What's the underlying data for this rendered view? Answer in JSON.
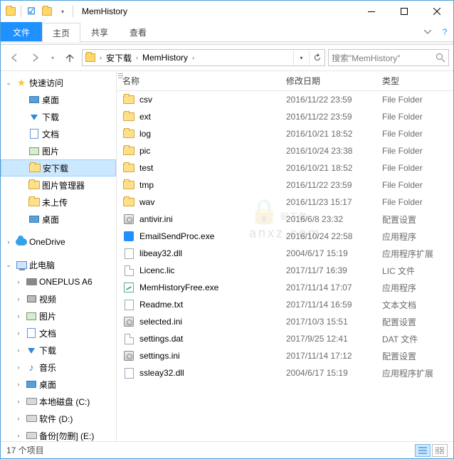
{
  "title": "MemHistory",
  "tabs": {
    "file": "文件",
    "home": "主页",
    "share": "共享",
    "view": "查看"
  },
  "breadcrumb": [
    "安下载",
    "MemHistory"
  ],
  "search_placeholder": "搜索\"MemHistory\"",
  "columns": {
    "name": "名称",
    "date": "修改日期",
    "type": "类型"
  },
  "items": [
    {
      "icon": "folder",
      "name": "csv",
      "date": "2016/11/22 23:59",
      "type": "File Folder"
    },
    {
      "icon": "folder",
      "name": "ext",
      "date": "2016/11/22 23:59",
      "type": "File Folder"
    },
    {
      "icon": "folder",
      "name": "log",
      "date": "2016/10/21 18:52",
      "type": "File Folder"
    },
    {
      "icon": "folder",
      "name": "pic",
      "date": "2016/10/24 23:38",
      "type": "File Folder"
    },
    {
      "icon": "folder",
      "name": "test",
      "date": "2016/10/21 18:52",
      "type": "File Folder"
    },
    {
      "icon": "folder",
      "name": "tmp",
      "date": "2016/11/22 23:59",
      "type": "File Folder"
    },
    {
      "icon": "folder",
      "name": "wav",
      "date": "2016/11/23 15:17",
      "type": "File Folder"
    },
    {
      "icon": "set",
      "name": "antivir.ini",
      "date": "2016/6/8 23:32",
      "type": "配置设置"
    },
    {
      "icon": "exe",
      "name": "EmailSendProc.exe",
      "date": "2016/10/24 22:58",
      "type": "应用程序"
    },
    {
      "icon": "dll",
      "name": "libeay32.dll",
      "date": "2004/6/17 15:19",
      "type": "应用程序扩展"
    },
    {
      "icon": "file",
      "name": "Licenc.lic",
      "date": "2017/11/7 16:39",
      "type": "LIC 文件"
    },
    {
      "icon": "exe2",
      "name": "MemHistoryFree.exe",
      "date": "2017/11/14 17:07",
      "type": "应用程序"
    },
    {
      "icon": "txt",
      "name": "Readme.txt",
      "date": "2017/11/14 16:59",
      "type": "文本文档"
    },
    {
      "icon": "set",
      "name": "selected.ini",
      "date": "2017/10/3 15:51",
      "type": "配置设置"
    },
    {
      "icon": "file",
      "name": "settings.dat",
      "date": "2017/9/25 12:41",
      "type": "DAT 文件"
    },
    {
      "icon": "set",
      "name": "settings.ini",
      "date": "2017/11/14 17:12",
      "type": "配置设置"
    },
    {
      "icon": "dll",
      "name": "ssleay32.dll",
      "date": "2004/6/17 15:19",
      "type": "应用程序扩展"
    }
  ],
  "sidebar": {
    "quick": "快速访问",
    "desktop": "桌面",
    "downloads": "下载",
    "documents": "文档",
    "pictures": "图片",
    "andl": "安下载",
    "picmgr": "图片管理器",
    "noupload": "未上传",
    "desktop2": "桌面",
    "onedrive": "OneDrive",
    "thispc": "此电脑",
    "oneplus": "ONEPLUS A6",
    "video": "视频",
    "pictures2": "图片",
    "documents2": "文档",
    "downloads2": "下载",
    "music": "音乐",
    "desktop3": "桌面",
    "cdisk": "本地磁盘 (C:)",
    "ddisk": "软件 (D:)",
    "edisk": "备份[勿删] (E:)"
  },
  "status": "17 个项目",
  "watermark": {
    "main": "安下载",
    "sub": "anxz.com"
  }
}
